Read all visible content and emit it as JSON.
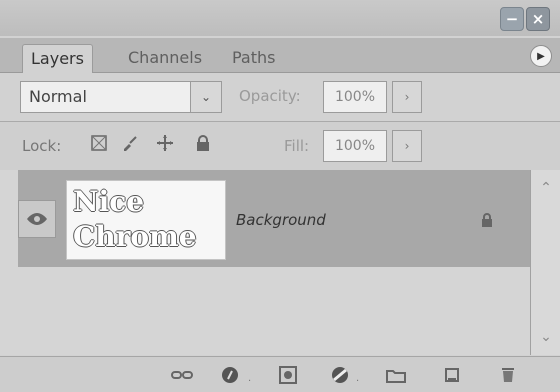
{
  "window": {
    "controls": {
      "minimize_icon": "minimize-icon",
      "close_icon": "close-icon"
    }
  },
  "tabs": [
    {
      "label": "Layers"
    },
    {
      "label": "Channels"
    },
    {
      "label": "Paths"
    }
  ],
  "blending": {
    "mode": "Normal",
    "opacity_label": "Opacity:",
    "opacity_value": "100%"
  },
  "lock": {
    "label": "Lock:",
    "fill_label": "Fill:",
    "fill_value": "100%"
  },
  "layers": [
    {
      "name": "Background",
      "thumbnail_line1": "Nice",
      "thumbnail_line2": "Chrome"
    }
  ]
}
